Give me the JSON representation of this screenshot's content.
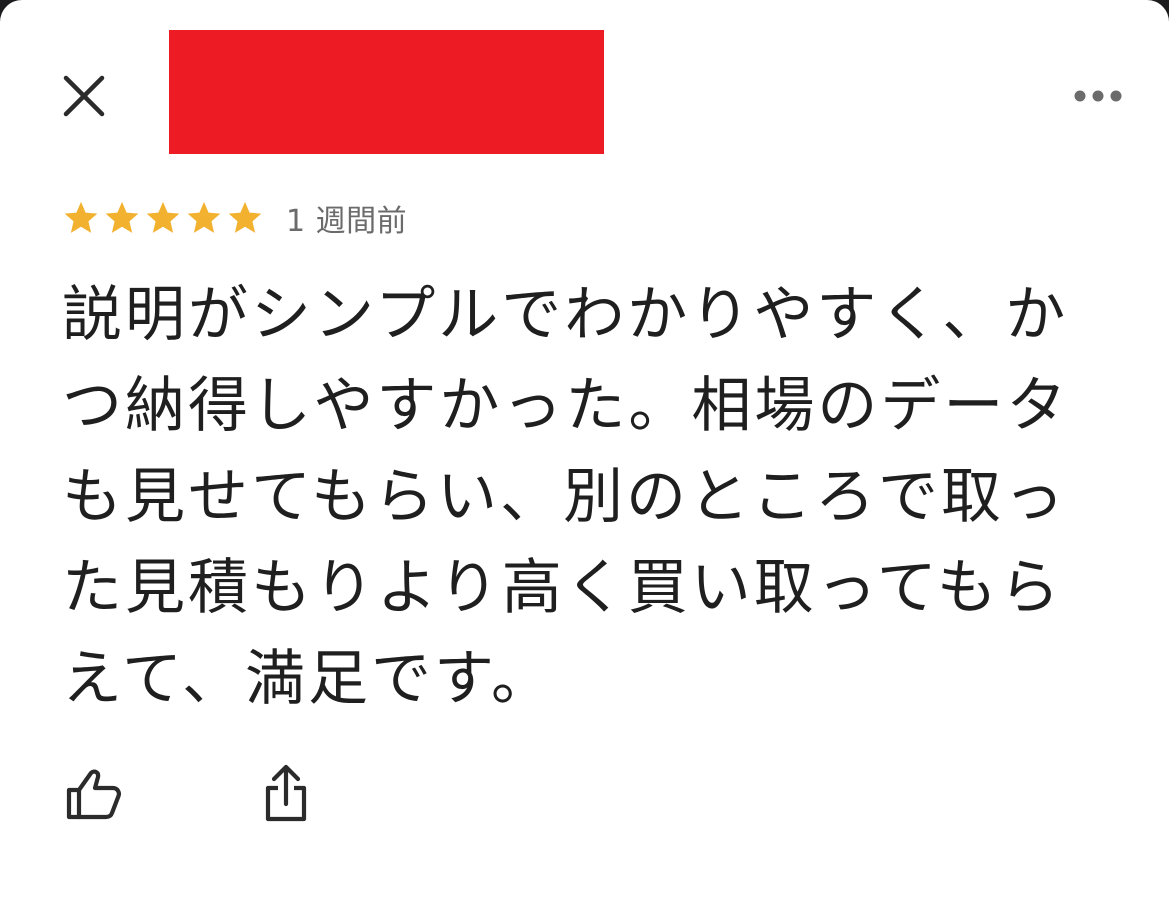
{
  "header": {
    "close_icon": "close-icon",
    "more_icon": "more-horizontal-icon",
    "redaction_color": "#ed1c24"
  },
  "review": {
    "rating": 5,
    "rating_max": 5,
    "star_color": "#f2b12f",
    "time_ago": "1 週間前",
    "text": "説明がシンプルでわかりやすく、かつ納得しやすかった。相場のデータも見せてもらい、別のところで取った見積もりより高く買い取ってもらえて、満足です。"
  },
  "actions": {
    "like_icon": "thumbs-up-icon",
    "share_icon": "share-icon"
  }
}
